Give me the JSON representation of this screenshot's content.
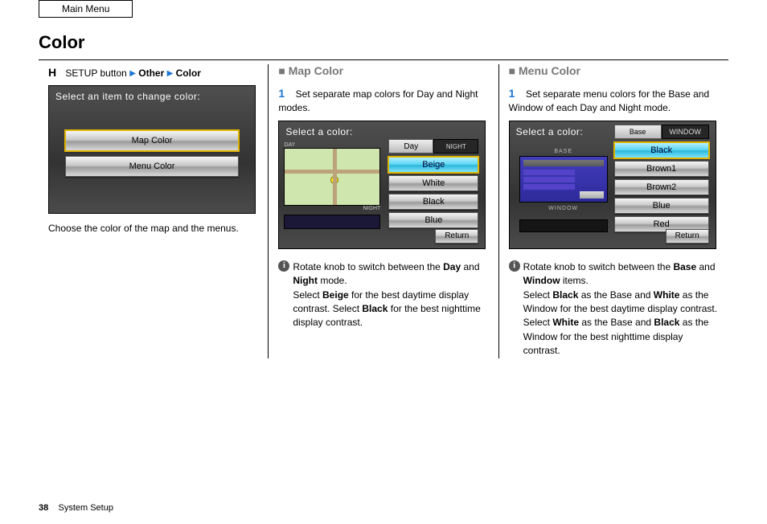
{
  "header": {
    "main_menu": "Main Menu",
    "title": "Color"
  },
  "col1": {
    "breadcrumb_parts": {
      "a": "SETUP button",
      "b": "Other",
      "c": "Color"
    },
    "unit": {
      "title": "Select an item to change color:",
      "options": [
        "Map Color",
        "Menu Color"
      ],
      "selected_index": 0
    },
    "text": "Choose the color of the map and the menus."
  },
  "col2": {
    "subhead": "Map Color",
    "lead_label": "1",
    "lead_text": "Set separate map colors for Day and Night modes.",
    "unit": {
      "title": "Select a color:",
      "day_label": "DAY",
      "night_label": "NIGHT",
      "tabs": {
        "active": "Day",
        "inactive": "NIGHT"
      },
      "options": [
        "Beige",
        "White",
        "Black",
        "Blue"
      ],
      "selected_index": 0,
      "return": "Return"
    },
    "body_parts": {
      "rotate": "Rotate ",
      "knob": "knob",
      "to_switch": " to switch between the ",
      "mode1": "Day",
      "and": " and ",
      "mode2": "Night",
      "mode_word": " mode.",
      "select_prefix": "Select ",
      "select_rest": "for the best daytime display contrast. Select ",
      "black": "Black",
      "rest2": " for the best nighttime display contrast."
    }
  },
  "col3": {
    "subhead": "Menu Color",
    "lead_label": "1",
    "lead_text": "Set separate menu colors for the Base and Window of each Day and Night mode.",
    "unit": {
      "title": "Select a color:",
      "base_label": "BASE",
      "window_label": "WINDOW",
      "tabs": {
        "active": "Base",
        "inactive": "WINDOW"
      },
      "options": [
        "Black",
        "Brown1",
        "Brown2",
        "Blue",
        "Red"
      ],
      "selected_index": 0,
      "return": "Return"
    },
    "body_parts": {
      "rotate": "Rotate ",
      "knob": "knob",
      "to_switch": " to switch between the ",
      "t1": "Base",
      "and": " and ",
      "t2": "Window",
      "items_word": " items.",
      "select": "Select ",
      "opt1": "Black",
      "mid1": " as the Base and ",
      "opt2": "White",
      "mid2": " as the Window for the best daytime display contrast. Select ",
      "opt3": "White",
      "mid3": " as the Base and ",
      "opt4": "Black",
      "mid4": " as the Window for the best nighttime display contrast."
    }
  },
  "footer": {
    "page": "38",
    "section": "System Setup"
  }
}
